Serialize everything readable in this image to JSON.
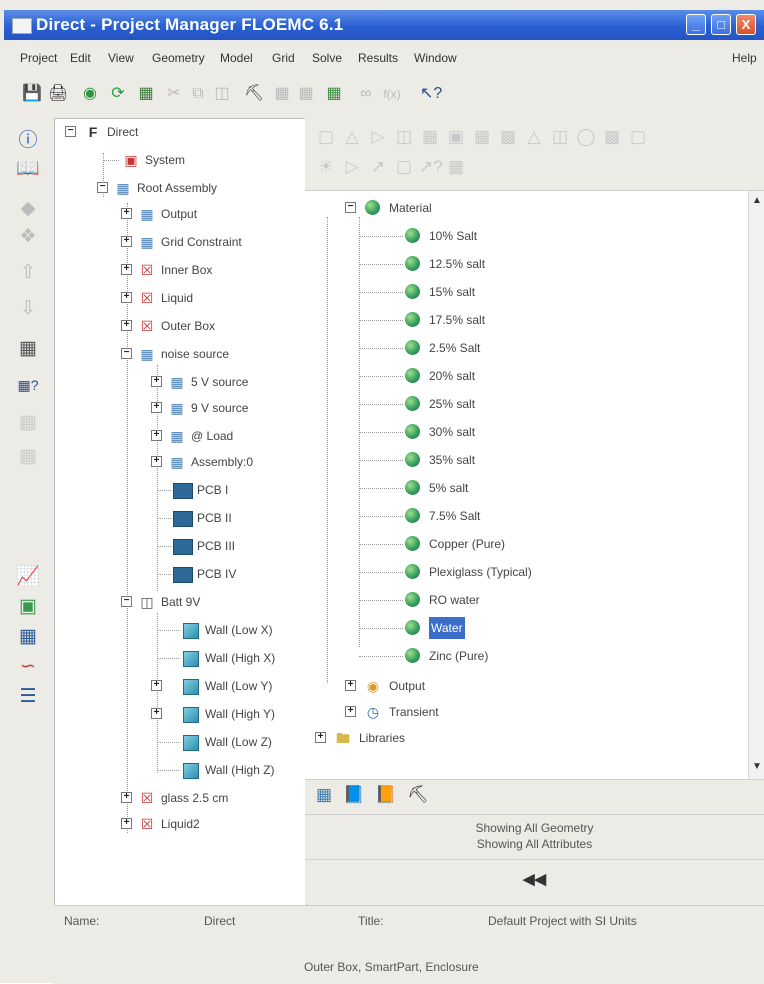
{
  "window": {
    "title": "Direct - Project Manager FLOEMC 6.1",
    "minimize": "_",
    "maximize": "□",
    "close": "X"
  },
  "menu": [
    "Project",
    "Edit",
    "View",
    "Geometry",
    "Model",
    "Grid",
    "Solve",
    "Results",
    "Window",
    "Help"
  ],
  "toolbar_icons": [
    "save-icon",
    "print-icon",
    "green-circle-icon",
    "green-arrow-icon",
    "assembly-icon",
    "cut-icon",
    "copy-icon",
    "paste-icon",
    "binoculars-icon",
    "grid-icon",
    "grid2-icon",
    "grid-check-icon",
    "glasses-icon",
    "fx-icon",
    "help-pointer-icon"
  ],
  "left_icons": [
    "info-icon",
    "book-icon",
    "diamond-icon",
    "diamond-x-icon",
    "up-arrow-icon",
    "down-arrow-icon",
    "grid-icon",
    "grid-help-icon",
    "grid-disabled-icon",
    "grid-disabled-2-icon",
    "chart-icon",
    "color-map-icon",
    "table-icon",
    "curve-icon",
    "tools-icon"
  ],
  "left_tree": [
    {
      "label": "Direct"
    },
    {
      "label": "System"
    },
    {
      "label": "Root Assembly"
    },
    {
      "label": "Output"
    },
    {
      "label": "Grid Constraint"
    },
    {
      "label": "Inner Box"
    },
    {
      "label": "Liquid"
    },
    {
      "label": "Outer Box"
    },
    {
      "label": "noise source"
    },
    {
      "label": "5 V source"
    },
    {
      "label": "9 V source"
    },
    {
      "label": "@ Load"
    },
    {
      "label": "Assembly:0"
    },
    {
      "label": "PCB I"
    },
    {
      "label": "PCB II"
    },
    {
      "label": "PCB III"
    },
    {
      "label": "PCB IV"
    },
    {
      "label": "Batt 9V"
    },
    {
      "label": "Wall (Low X)"
    },
    {
      "label": "Wall (High X)"
    },
    {
      "label": "Wall (Low Y)"
    },
    {
      "label": "Wall (High Y)"
    },
    {
      "label": "Wall (Low Z)"
    },
    {
      "label": "Wall (High Z)"
    },
    {
      "label": "glass 2.5 cm"
    },
    {
      "label": "Liquid2"
    }
  ],
  "right_tree": [
    {
      "label": "Material"
    },
    {
      "label": "10% Salt"
    },
    {
      "label": "12.5% salt"
    },
    {
      "label": "15% salt"
    },
    {
      "label": "17.5% salt"
    },
    {
      "label": "2.5% Salt"
    },
    {
      "label": "20% salt"
    },
    {
      "label": "25% salt"
    },
    {
      "label": "30% salt"
    },
    {
      "label": "35% salt"
    },
    {
      "label": "5% salt"
    },
    {
      "label": "7.5% Salt"
    },
    {
      "label": "Copper (Pure)"
    },
    {
      "label": "Plexiglass (Typical)"
    },
    {
      "label": "RO water"
    },
    {
      "label": "Water"
    },
    {
      "label": "Zinc (Pure)"
    },
    {
      "label": "Output"
    },
    {
      "label": "Transient"
    },
    {
      "label": "Libraries"
    }
  ],
  "status": {
    "line1": "Showing All Geometry",
    "line2": "Showing All Attributes",
    "collapse": "◀◀"
  },
  "footer": {
    "name_label": "Name:",
    "name_value": "Direct",
    "title_label": "Title:",
    "title_value": "Default Project with SI Units",
    "selection": "Outer Box, SmartPart, Enclosure"
  }
}
